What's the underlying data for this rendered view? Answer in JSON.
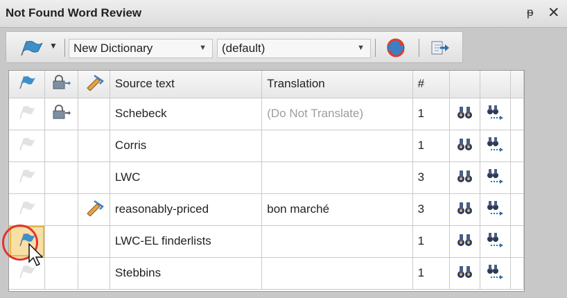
{
  "panel": {
    "title": "Not Found Word Review",
    "pin_icon": "pin-icon",
    "close_icon": "close-icon"
  },
  "toolbar": {
    "flag_button_icon": "flag-icon",
    "dictionary_combo": {
      "value": "New Dictionary"
    },
    "profile_combo": {
      "value": "(default)"
    },
    "sync_button_icon": "sync-icon",
    "merge_button_icon": "merge-icon"
  },
  "grid": {
    "columns": [
      "Source text",
      "Translation",
      "#"
    ],
    "icon_columns": [
      "flag-icon",
      "lock-icon",
      "pencil-icon",
      "find-icon",
      "find-next-icon"
    ],
    "rows": [
      {
        "source": "Schebeck",
        "translation": "(Do Not Translate)",
        "count": "1",
        "locked": true,
        "edited": false,
        "flag_active": false
      },
      {
        "source": "Corris",
        "translation": "",
        "count": "1",
        "locked": false,
        "edited": false,
        "flag_active": false
      },
      {
        "source": "LWC",
        "translation": "",
        "count": "3",
        "locked": false,
        "edited": false,
        "flag_active": false
      },
      {
        "source": "reasonably-priced",
        "translation": "bon marché",
        "count": "3",
        "locked": false,
        "edited": true,
        "flag_active": false
      },
      {
        "source": "LWC-EL finderlists",
        "translation": "",
        "count": "1",
        "locked": false,
        "edited": false,
        "flag_active": true
      },
      {
        "source": "Stebbins",
        "translation": "",
        "count": "1",
        "locked": false,
        "edited": false,
        "flag_active": false
      }
    ]
  },
  "colors": {
    "highlight_circle": "#e2322f",
    "selected_cell": "#f7dfa5",
    "flag_blue": "#3e8fc8"
  }
}
